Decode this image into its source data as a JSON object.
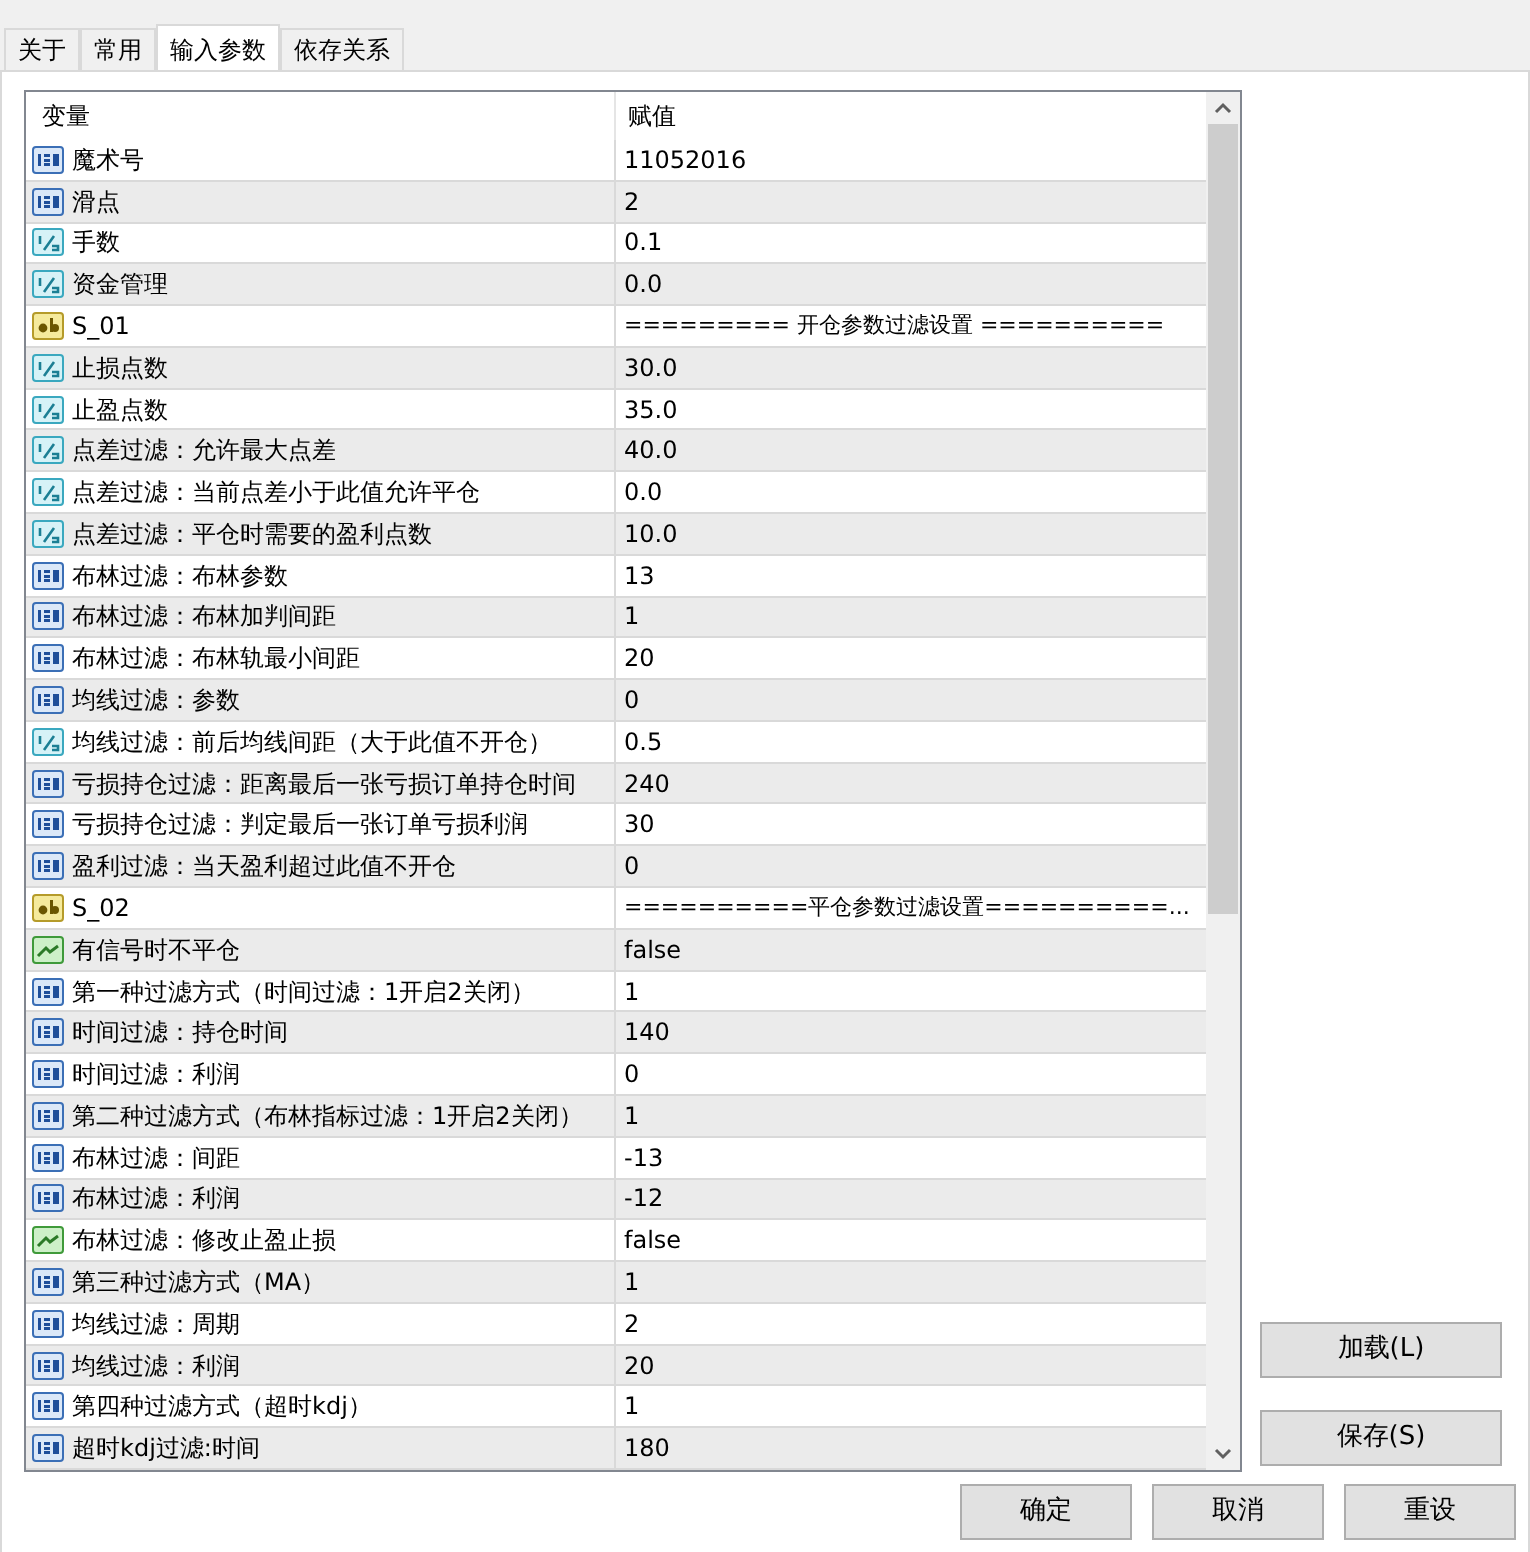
{
  "tabs": [
    {
      "label": "关于",
      "selected": false
    },
    {
      "label": "常用",
      "selected": false
    },
    {
      "label": "输入参数",
      "selected": true
    },
    {
      "label": "依存关系",
      "selected": false
    }
  ],
  "table": {
    "columns": [
      "变量",
      "赋值"
    ],
    "rows": [
      {
        "kind": "int",
        "name": "魔术号",
        "value": "11052016"
      },
      {
        "kind": "int",
        "name": "滑点",
        "value": "2"
      },
      {
        "kind": "double",
        "name": "手数",
        "value": "0.1"
      },
      {
        "kind": "double",
        "name": "资金管理",
        "value": "0.0"
      },
      {
        "kind": "string",
        "name": "S_01",
        "value": "========= 开仓参数过滤设置 =========="
      },
      {
        "kind": "double",
        "name": "止损点数",
        "value": "30.0"
      },
      {
        "kind": "double",
        "name": "止盈点数",
        "value": "35.0"
      },
      {
        "kind": "double",
        "name": "点差过滤：允许最大点差",
        "value": "40.0"
      },
      {
        "kind": "double",
        "name": "点差过滤：当前点差小于此值允许平仓",
        "value": "0.0"
      },
      {
        "kind": "double",
        "name": "点差过滤：平仓时需要的盈利点数",
        "value": "10.0"
      },
      {
        "kind": "int",
        "name": "布林过滤：布林参数",
        "value": "13"
      },
      {
        "kind": "int",
        "name": "布林过滤：布林加判间距",
        "value": "1"
      },
      {
        "kind": "int",
        "name": "布林过滤：布林轨最小间距",
        "value": "20"
      },
      {
        "kind": "int",
        "name": "均线过滤：参数",
        "value": "0"
      },
      {
        "kind": "double",
        "name": "均线过滤：前后均线间距（大于此值不开仓）",
        "value": "0.5"
      },
      {
        "kind": "int",
        "name": "亏损持仓过滤：距离最后一张亏损订单持仓时间",
        "value": "240"
      },
      {
        "kind": "int",
        "name": "亏损持仓过滤：判定最后一张订单亏损利润",
        "value": "30"
      },
      {
        "kind": "int",
        "name": "盈利过滤：当天盈利超过此值不开仓",
        "value": "0"
      },
      {
        "kind": "string",
        "name": "S_02",
        "value": "==========平仓参数过滤设置==========..."
      },
      {
        "kind": "bool",
        "name": "有信号时不平仓",
        "value": "false"
      },
      {
        "kind": "int",
        "name": "第一种过滤方式（时间过滤：1开启2关闭）",
        "value": "1"
      },
      {
        "kind": "int",
        "name": "时间过滤：持仓时间",
        "value": "140"
      },
      {
        "kind": "int",
        "name": "时间过滤：利润",
        "value": "0"
      },
      {
        "kind": "int",
        "name": "第二种过滤方式（布林指标过滤：1开启2关闭）",
        "value": "1"
      },
      {
        "kind": "int",
        "name": "布林过滤：间距",
        "value": "-13"
      },
      {
        "kind": "int",
        "name": "布林过滤：利润",
        "value": "-12"
      },
      {
        "kind": "bool",
        "name": "布林过滤：修改止盈止损",
        "value": "false"
      },
      {
        "kind": "int",
        "name": "第三种过滤方式（MA）",
        "value": "1"
      },
      {
        "kind": "int",
        "name": "均线过滤：周期",
        "value": "2"
      },
      {
        "kind": "int",
        "name": "均线过滤：利润",
        "value": "20"
      },
      {
        "kind": "int",
        "name": "第四种过滤方式（超时kdj）",
        "value": "1"
      },
      {
        "kind": "int",
        "name": "超时kdj过滤:时间",
        "value": "180"
      }
    ]
  },
  "side_buttons": [
    "加载(L)",
    "保存(S)"
  ],
  "buttons": [
    "确定",
    "取消",
    "重设"
  ]
}
